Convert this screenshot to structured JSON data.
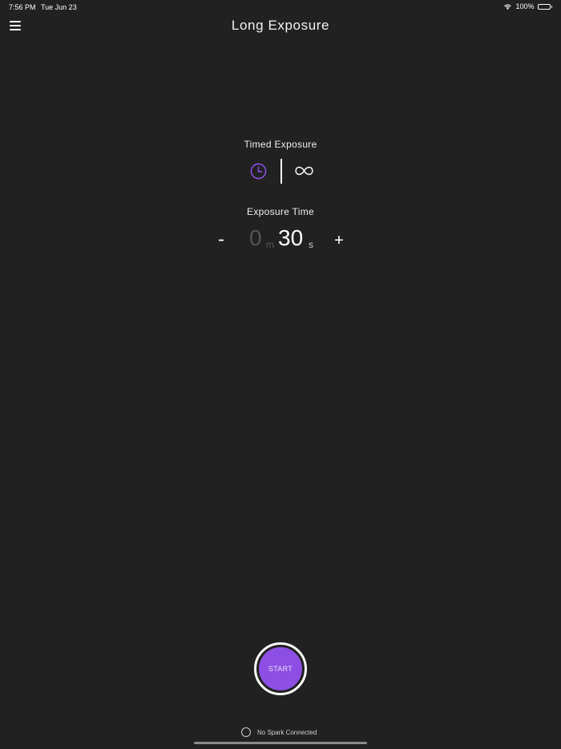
{
  "status_bar": {
    "time": "7:56 PM",
    "date": "Tue Jun 23",
    "battery": "100%"
  },
  "header": {
    "title": "Long Exposure"
  },
  "mode": {
    "label": "Timed Exposure",
    "options": [
      "clock-icon",
      "infinity-icon"
    ],
    "selected": "clock-icon",
    "accent_color": "#8d4fe3",
    "infinity_symbol": "∞"
  },
  "exposure_time": {
    "label": "Exposure Time",
    "minus_label": "-",
    "plus_label": "+",
    "minutes": "0",
    "minutes_unit": "m",
    "seconds": "30",
    "seconds_unit": "s"
  },
  "start_button": {
    "label": "START",
    "color": "#8d4fe3"
  },
  "connection": {
    "label": "No Spark Connected"
  }
}
